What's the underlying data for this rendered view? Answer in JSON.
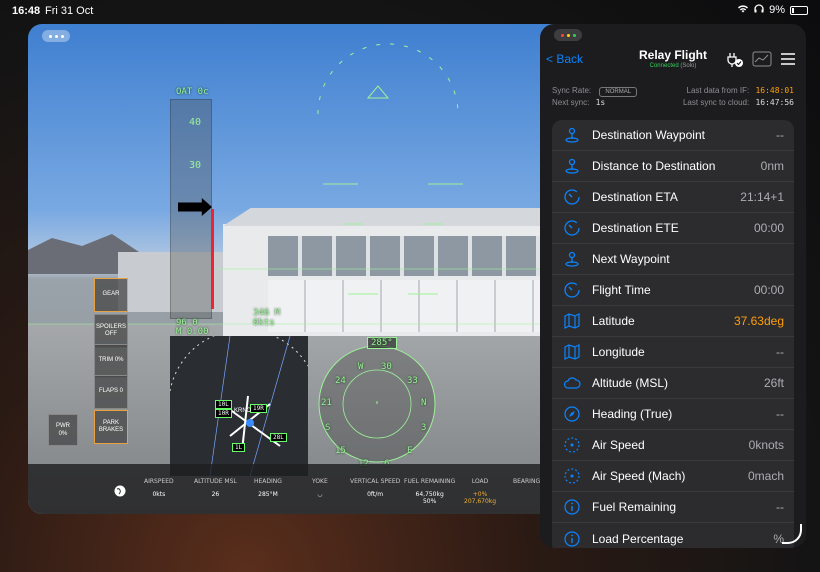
{
  "status": {
    "time": "16:48",
    "date": "Fri 31 Oct",
    "battery": "9%"
  },
  "hud": {
    "oat": "OAT 0c",
    "speed_ticks": [
      "40",
      "30"
    ],
    "alt": "346 M",
    "gs": "0kts",
    "left_vals": [
      "96 0",
      "M 0.00"
    ],
    "heading_box": "285°"
  },
  "side_buttons": [
    {
      "label": "GEAR"
    },
    {
      "label": "SPOILERS OFF"
    },
    {
      "label": "TRIM 0%"
    },
    {
      "label": "FLAPS 0"
    },
    {
      "label": "PARK BRAKES"
    }
  ],
  "pwr": {
    "label": "PWR",
    "value": "0%"
  },
  "map": {
    "runways": [
      "10L",
      "19R",
      "10R",
      "28L",
      "1L"
    ],
    "airport": "KRNO"
  },
  "compass": {
    "labels": [
      "W",
      "30",
      "33",
      "24",
      "N",
      "21",
      "3",
      "S",
      "E",
      "15",
      "12",
      "6"
    ]
  },
  "bottom_bar": [
    {
      "label": "AIRSPEED",
      "value": "0kts"
    },
    {
      "label": "ALTITUDE MSL",
      "value": "26"
    },
    {
      "label": "HEADING",
      "value": "285°M"
    },
    {
      "label": "YOKE",
      "value": ""
    },
    {
      "label": "VERTICAL SPEED",
      "value": "0ft/m"
    },
    {
      "label": "FUEL REMAINING",
      "value": "64,750kg"
    },
    {
      "label": "LOAD",
      "value": "+0%"
    },
    {
      "label": "BEARING T",
      "value": ""
    }
  ],
  "fuel_sub": "50%",
  "load_sub": "207,670kg",
  "panel": {
    "back": "< Back",
    "title": "Relay Flight",
    "connected": "Connected",
    "solo": "(Solo)",
    "sync_rate_label": "Sync Rate:",
    "sync_rate_badge": "NORMAL",
    "next_sync_label": "Next sync:",
    "next_sync_value": "1s",
    "last_data_label": "Last data from IF:",
    "last_data_value": "16:48:01",
    "last_sync_label": "Last sync to cloud:",
    "last_sync_value": "16:47:56",
    "rows": [
      {
        "icon": "waypoint-icon",
        "label": "Destination Waypoint",
        "value": "--"
      },
      {
        "icon": "waypoint-icon",
        "label": "Distance to Destination",
        "value": "0nm"
      },
      {
        "icon": "timer-icon",
        "label": "Destination ETA",
        "value": "21:14+1"
      },
      {
        "icon": "timer-icon",
        "label": "Destination ETE",
        "value": "00:00"
      },
      {
        "icon": "waypoint-icon",
        "label": "Next Waypoint",
        "value": ""
      },
      {
        "icon": "timer-icon",
        "label": "Flight Time",
        "value": "00:00"
      },
      {
        "icon": "map-icon",
        "label": "Latitude",
        "value": "37.63deg",
        "highlight": true
      },
      {
        "icon": "map-icon",
        "label": "Longitude",
        "value": "--"
      },
      {
        "icon": "cloud-icon",
        "label": "Altitude (MSL)",
        "value": "26ft"
      },
      {
        "icon": "compass-icon",
        "label": "Heading (True)",
        "value": "--"
      },
      {
        "icon": "gauge-icon",
        "label": "Air Speed",
        "value": "0knots"
      },
      {
        "icon": "gauge-icon",
        "label": "Air Speed (Mach)",
        "value": "0mach"
      },
      {
        "icon": "info-icon",
        "label": "Fuel Remaining",
        "value": "--"
      },
      {
        "icon": "info-icon",
        "label": "Load Percentage",
        "value": "%"
      }
    ]
  }
}
